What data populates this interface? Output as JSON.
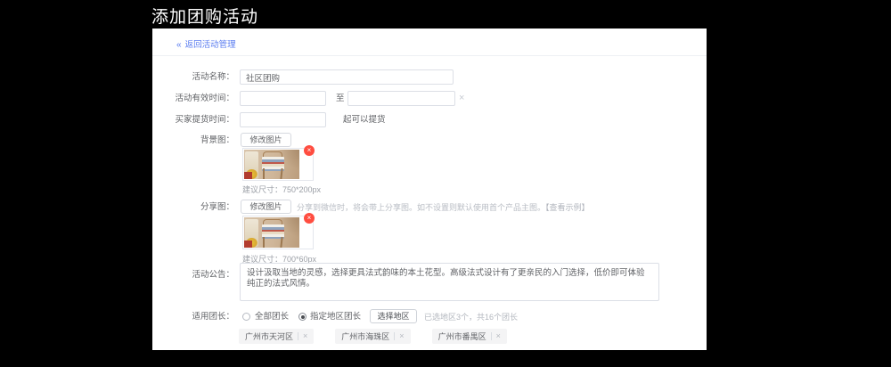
{
  "page": {
    "title": "添加团购活动"
  },
  "panel": {
    "back": {
      "icon": "«",
      "label": "返回活动管理"
    }
  },
  "form": {
    "name": {
      "label": "活动名称：",
      "value": "社区团购"
    },
    "valid_time": {
      "label": "活动有效时间：",
      "start_value": "",
      "separator": "至",
      "end_value": "",
      "clear_icon": "×"
    },
    "pickup_time": {
      "label": "买家提货时间：",
      "value": "",
      "suffix": "起可以提货"
    },
    "bg_image": {
      "label": "背景图：",
      "change_button": "修改图片",
      "remove_icon": "×",
      "size_hint": "建议尺寸：750*200px"
    },
    "share_image": {
      "label": "分享图：",
      "change_button": "修改图片",
      "hint": "分享到微信时，将会带上分享图。如不设置则默认使用首个产品主图。",
      "example_link": "【查看示例】",
      "remove_icon": "×",
      "size_hint": "建议尺寸：700*60px"
    },
    "notice": {
      "label": "活动公告：",
      "value": "设计汲取当地的灵感，选择更具法式韵味的本土花型。高级法式设计有了更亲民的入门选择，低价即可体验纯正的法式风情。"
    },
    "leader": {
      "label": "适用团长：",
      "options": [
        {
          "label": "全部团长",
          "checked": false
        },
        {
          "label": "指定地区团长",
          "checked": true
        }
      ],
      "select_button": "选择地区",
      "summary": "已选地区3个，共16个团长",
      "tags": [
        {
          "label": "广州市天河区",
          "close": "×"
        },
        {
          "label": "广州市海珠区",
          "close": "×"
        },
        {
          "label": "广州市番禺区",
          "close": "×"
        }
      ]
    }
  },
  "colors": {
    "accent_red": "#ff4d40",
    "link_blue": "#5a7cf0"
  }
}
